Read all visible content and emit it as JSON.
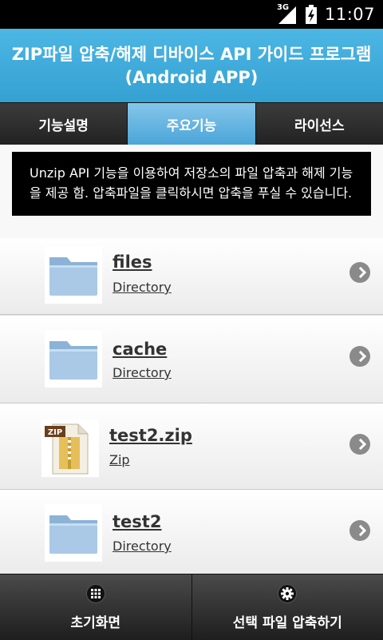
{
  "status_bar": {
    "network": "3G",
    "time": "11:07"
  },
  "header": {
    "title_line1": "ZIP파일 압축/해제 디바이스 API 가이드 프로그램",
    "title_line2": "(Android APP)"
  },
  "tabs": [
    {
      "label": "기능설명",
      "active": false
    },
    {
      "label": "주요기능",
      "active": true
    },
    {
      "label": "라이선스",
      "active": false
    }
  ],
  "description": "Unzip API 기능을 이용하여 저장소의 파일 압축과 해제 기능을 제공 함. 압축파일을 클릭하시면 압축을 푸실 수 있습니다.",
  "files": [
    {
      "name": "files",
      "type": "Directory",
      "icon": "folder-icon"
    },
    {
      "name": "cache",
      "type": "Directory",
      "icon": "folder-icon"
    },
    {
      "name": "test2.zip",
      "type": "Zip",
      "icon": "zip-file-icon",
      "icon_label": "ZIP"
    },
    {
      "name": "test2",
      "type": "Directory",
      "icon": "folder-icon"
    }
  ],
  "footer": {
    "home_label": "초기화면",
    "home_icon": "grid-icon",
    "compress_label": "선택 파일 압축하기",
    "compress_icon": "gear-icon"
  },
  "colors": {
    "header": "#3aa6d6",
    "active_tab": "#6ab7e3",
    "tab": "#2e2e2e"
  }
}
